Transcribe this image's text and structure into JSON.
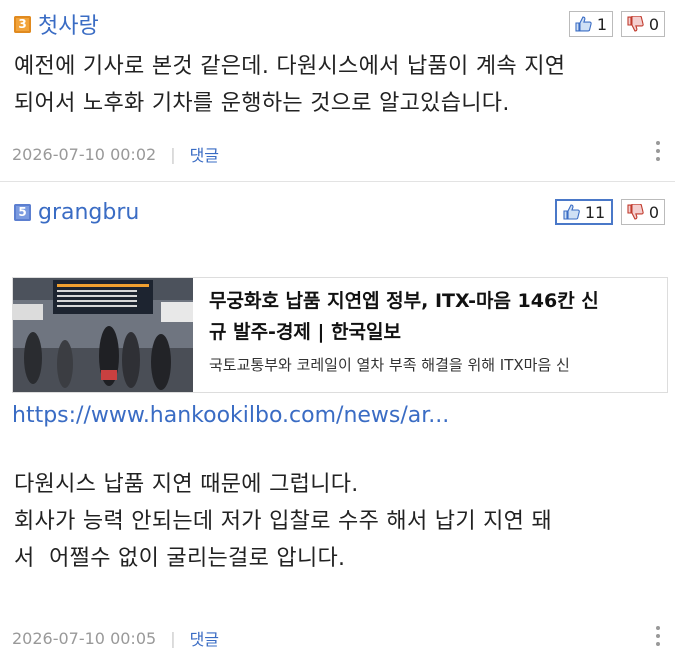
{
  "comments": [
    {
      "level": "3",
      "author": "첫사랑",
      "upvotes": "1",
      "downvotes": "0",
      "text": "예전에 기사로 본것 같은데. 다원시스에서 납품이 계속 지연\n되어서 노후화 기차를 운행하는 것으로 알고있습니다.",
      "timestamp": "2026-07-10 00:02",
      "reply_label": "댓글"
    },
    {
      "level": "5",
      "author": "grangbru",
      "upvotes": "11",
      "downvotes": "0",
      "link_card": {
        "title": "무궁화호 납품 지연엡 정부, ITX-마음 146칸 신\n규 발주-경제 | 한국일보",
        "description": "국토교통부와 코레일이 열차 부족 해결을 위해 ITX마음 신"
      },
      "url": "https://www.hankookilbo.com/news/ar...",
      "text": "다원시스 납품 지연 때문에 그럽니다.\n회사가 능력 안되는데 저가 입찰로 수주 해서 납기 지연 돼\n서  어쩔수 없이 굴리는걸로 압니다.",
      "timestamp": "2026-07-10 00:05",
      "reply_label": "댓글"
    }
  ],
  "colors": {
    "accent": "#3a6cc4",
    "meta": "#999999",
    "level3": "#f2a33a",
    "level5": "#7b9be0"
  },
  "icons": {
    "upvote": "thumbs-up-icon",
    "downvote": "thumbs-down-icon",
    "more": "more-vertical-icon"
  }
}
